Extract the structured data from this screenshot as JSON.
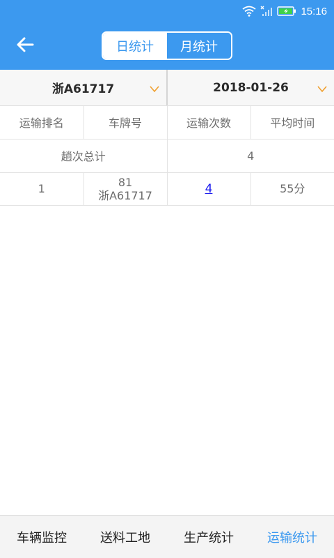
{
  "status_bar": {
    "time": "15:16",
    "icons": [
      "wifi-icon",
      "no-signal-icon",
      "battery-charging-icon"
    ]
  },
  "header": {
    "back_icon": "arrow-left-icon",
    "tabs": [
      {
        "label": "日统计",
        "selected": false
      },
      {
        "label": "月统计",
        "selected": true
      }
    ]
  },
  "filters": {
    "vehicle": "浙A61717",
    "date": "2018-01-26",
    "dropdown_icon": "chevron-down-icon"
  },
  "table": {
    "headers": [
      "运输排名",
      "车牌号",
      "运输次数",
      "平均时间"
    ],
    "total": {
      "label": "趟次总计",
      "value": "4"
    },
    "rows": [
      {
        "rank": "1",
        "plate_line1": "81",
        "plate_line2": "浙A61717",
        "trips": "4",
        "avg_time": "55分"
      }
    ]
  },
  "bottom_nav": {
    "items": [
      {
        "label": "车辆监控",
        "active": false
      },
      {
        "label": "送料工地",
        "active": false
      },
      {
        "label": "生产统计",
        "active": false
      },
      {
        "label": "运输统计",
        "active": true
      }
    ]
  },
  "colors": {
    "accent": "#3c99ef",
    "dropdown_arrow": "#f0a030",
    "link": "#1a1aee"
  }
}
